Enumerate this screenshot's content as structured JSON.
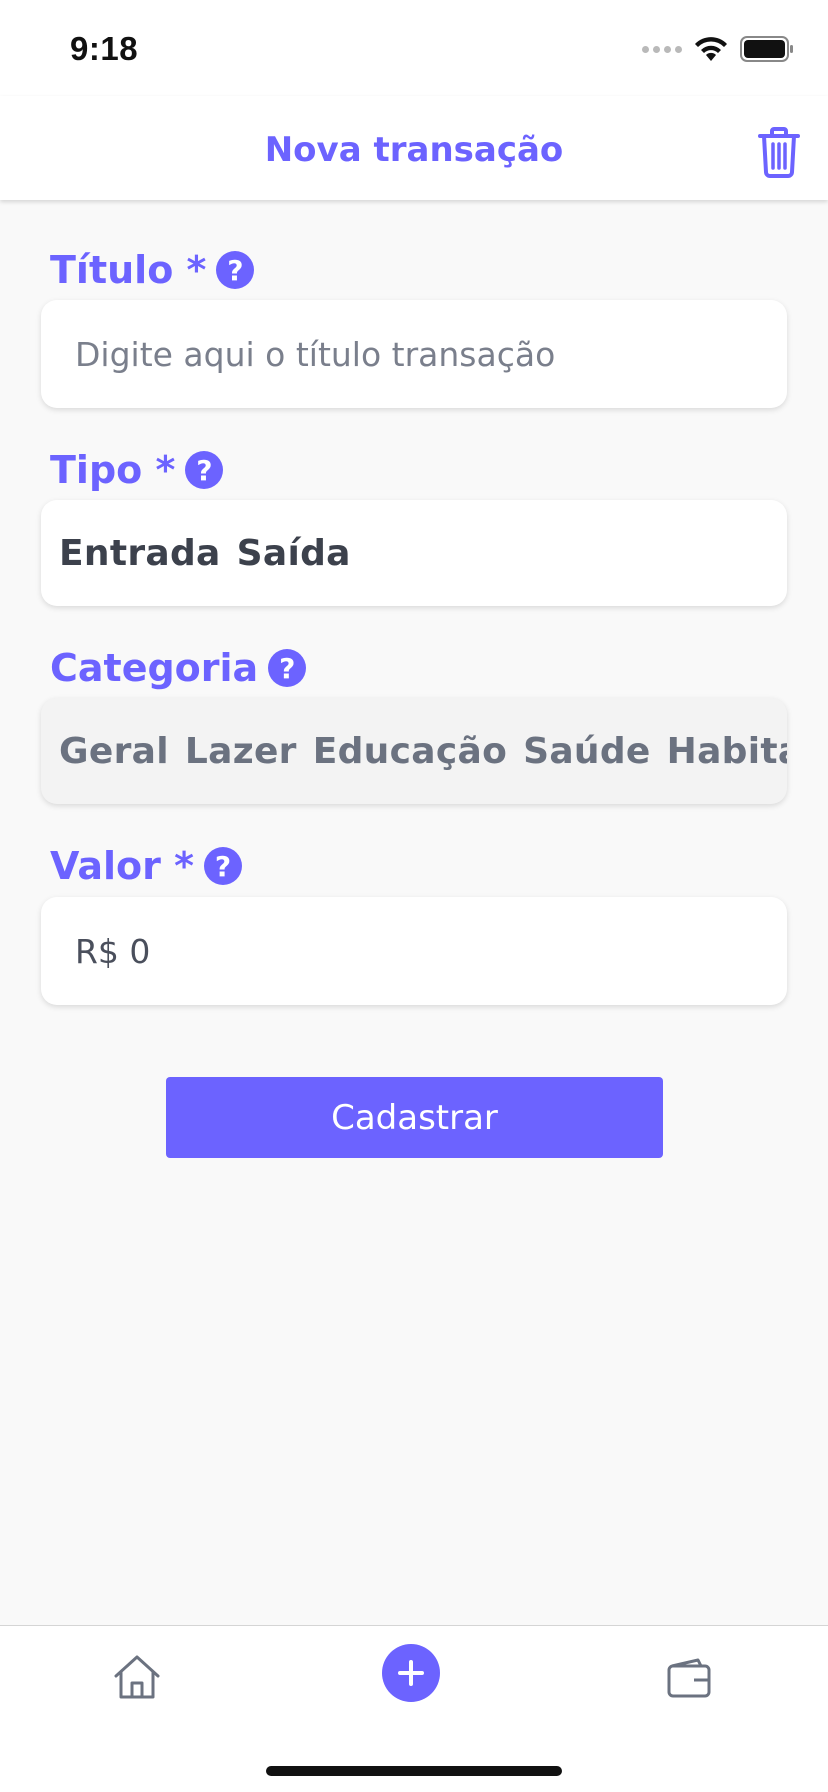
{
  "status_bar": {
    "time": "9:18"
  },
  "header": {
    "title": "Nova transação"
  },
  "form": {
    "title_field": {
      "label": "Título *",
      "placeholder": "Digite aqui o título transação",
      "value": ""
    },
    "type_field": {
      "label": "Tipo *",
      "options": [
        "Entrada",
        "Saída"
      ]
    },
    "category_field": {
      "label": "Categoria",
      "options": [
        "Geral",
        "Lazer",
        "Educação",
        "Saúde",
        "Habitação"
      ]
    },
    "amount_field": {
      "label": "Valor *",
      "value": "R$ 0"
    },
    "help_symbol": "?",
    "submit_label": "Cadastrar"
  },
  "colors": {
    "accent": "#6c63ff",
    "text_dark": "#3c414c",
    "text_muted": "#6b7280",
    "background": "#f9f9f9"
  },
  "icons": {
    "header_action": "trash-icon",
    "tabs": [
      "home-icon",
      "add-icon",
      "wallet-icon"
    ]
  }
}
